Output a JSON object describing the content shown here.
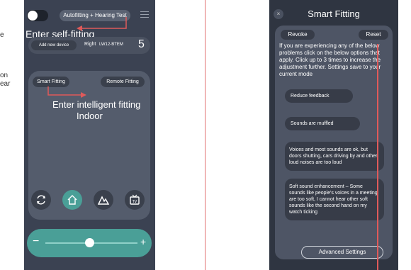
{
  "left_cut": {
    "lines": [
      "e",
      "",
      "",
      "on",
      "ear"
    ]
  },
  "screen1": {
    "test_button": "Autofitting + Hearing Test",
    "annotation_self": "Enter self-fitting",
    "add_device": "Add new device",
    "device_side": "Right",
    "device_model": "LW12-BTEM",
    "device_program": "5",
    "smart_fitting": "Smart Fitting",
    "remote_fitting": "Remote Fitting",
    "annotation_intelligent": "Enter intelligent fitting",
    "annotation_indoor": "Indoor",
    "icons": [
      "refresh-icon",
      "home-icon",
      "mountain-icon",
      "tv-icon"
    ],
    "volume_minus": "−",
    "volume_plus": "+",
    "volume_level": 0.55
  },
  "screen2": {
    "close": "×",
    "title": "Smart Fitting",
    "revoke": "Revoke",
    "reset": "Reset",
    "instructions": "If you are experiencing any of the below problems click on the below options that apply. Click up to 3 times to increase the adjustment further. Settings save to your current mode",
    "options": [
      "Reduce feedback",
      "Sounds are muffled",
      "Voices and most sounds are ok, but doors shutting, cars driving by and other loud noises are too loud",
      "Soft sound enhancement – Some sounds like people's voices in a meeting are too soft, I cannot hear other soft sounds like the second hand on my watch ticking"
    ],
    "advanced": "Advanced Settings"
  },
  "colors": {
    "accent_red": "#e05a5a",
    "teal": "#4a9f97",
    "dark_bg": "#3b4252"
  }
}
